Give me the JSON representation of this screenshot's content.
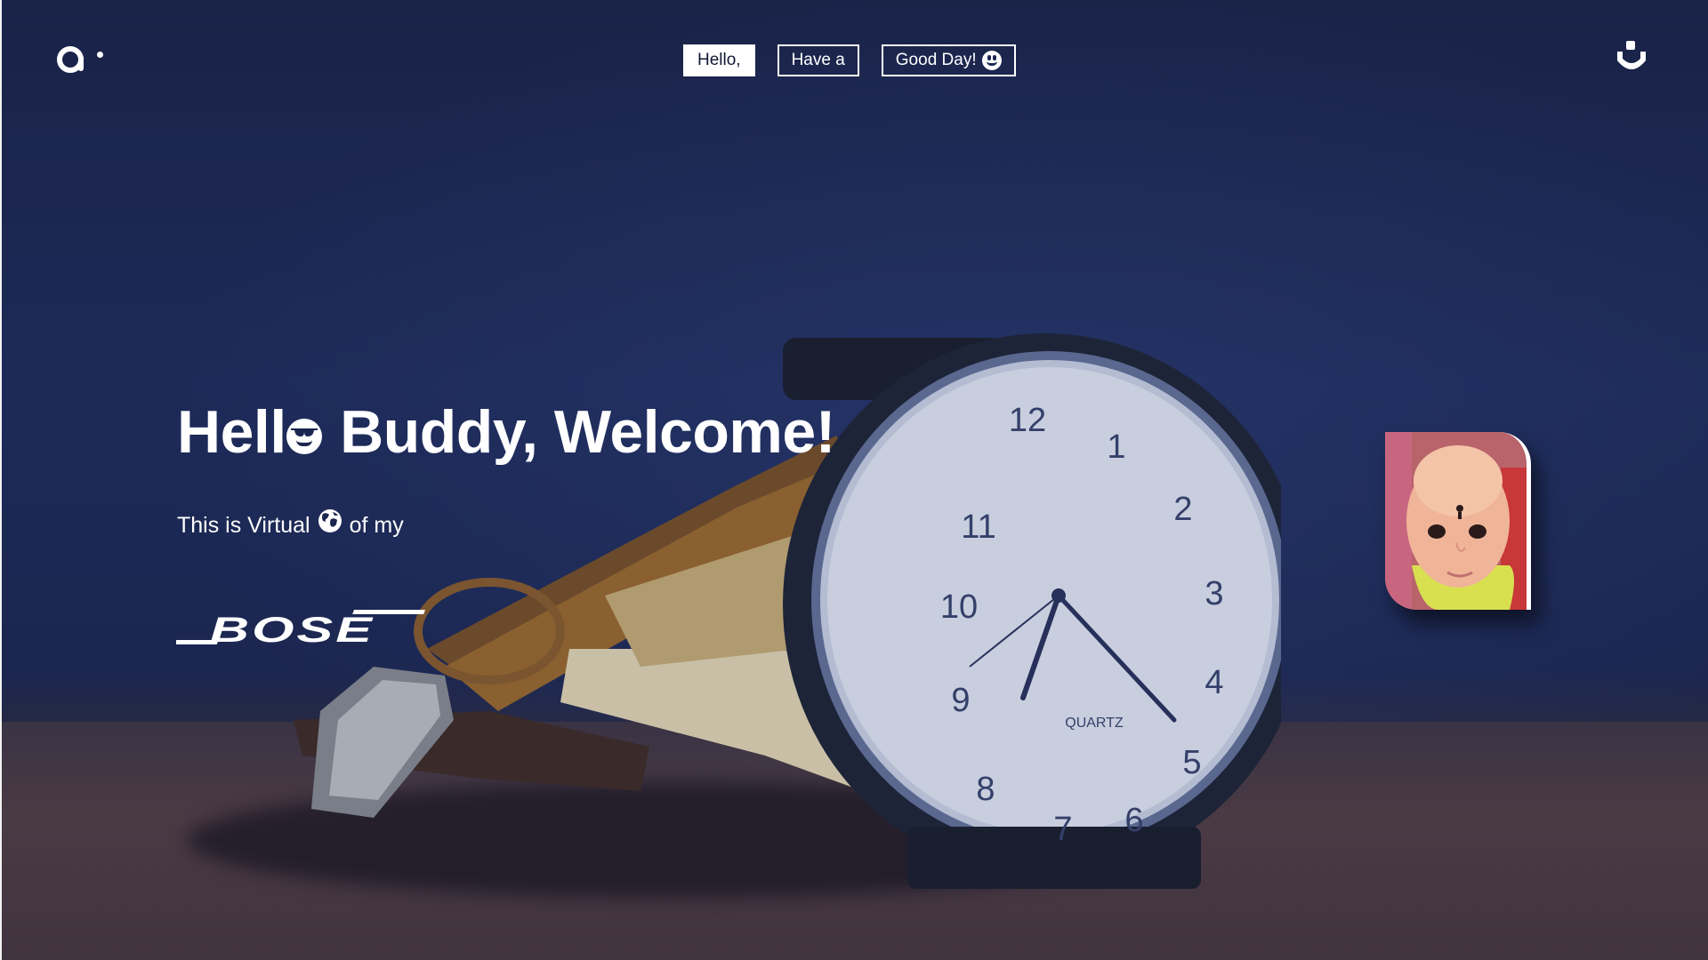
{
  "header": {
    "logo_icon": "brand-a-icon",
    "nav_buttons": [
      {
        "label": "Hello,",
        "style": "solid"
      },
      {
        "label": "Have a",
        "style": "outline"
      },
      {
        "label": "Good Day!",
        "style": "outline",
        "icon": "smiley-icon"
      }
    ],
    "menu_icon": "smile-u-icon"
  },
  "hero": {
    "title_part1": "Hell",
    "title_icon": "sunglasses-face-icon",
    "title_part2": " Buddy, Welcome!",
    "subtitle_part1": "This is Virtual",
    "subtitle_icon": "globe-icon",
    "subtitle_part2": "of my",
    "brand_logo": "BOSE"
  },
  "watch": {
    "numerals": [
      "12",
      "1",
      "2",
      "3",
      "4",
      "5",
      "6",
      "7",
      "8",
      "9",
      "10",
      "11"
    ],
    "label": "QUARTZ"
  },
  "colors": {
    "background": "#1b2650",
    "text": "#ffffff",
    "button_fill": "#ffffff",
    "button_text": "#111833"
  }
}
